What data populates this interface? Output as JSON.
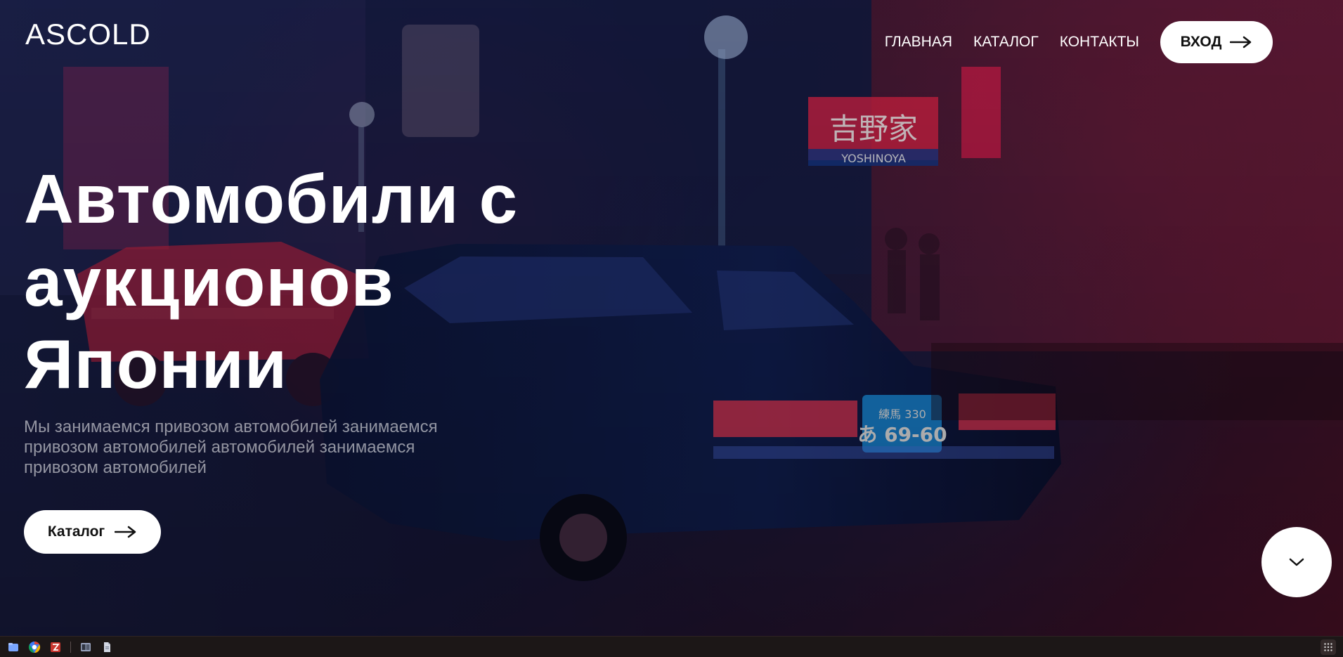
{
  "brand": "ASCOLD",
  "nav": {
    "items": [
      "ГЛАВНАЯ",
      "КАТАЛОГ",
      "КОНТАКТЫ"
    ],
    "login_label": "ВХОД"
  },
  "hero": {
    "headline_lines": [
      "Автомобили с",
      "аукционов",
      "Японии"
    ],
    "subtitle_lines": [
      "Мы занимаемся привозом автомобилей занимаемся",
      "привозом автомобилей автомобилей занимаемся",
      "привозом автомобилей"
    ],
    "catalog_button": "Каталог"
  },
  "scene_text": {
    "sign_store": "吉野家",
    "sign_store_latin": "YOSHINOYA",
    "plate_top": "練馬 330",
    "plate_bottom": "あ 69-60"
  },
  "icons": {
    "arrow": "arrow-right-icon",
    "scroll": "chevron-down-icon",
    "taskbar": [
      "files-icon",
      "chrome-icon",
      "filezilla-icon",
      "window-icon",
      "document-icon",
      "apps-grid-icon"
    ]
  },
  "colors": {
    "accent": "#ffffff",
    "overlay_blue": "#182456",
    "overlay_red": "#5a142d",
    "text_muted": "#a6a3ab"
  }
}
